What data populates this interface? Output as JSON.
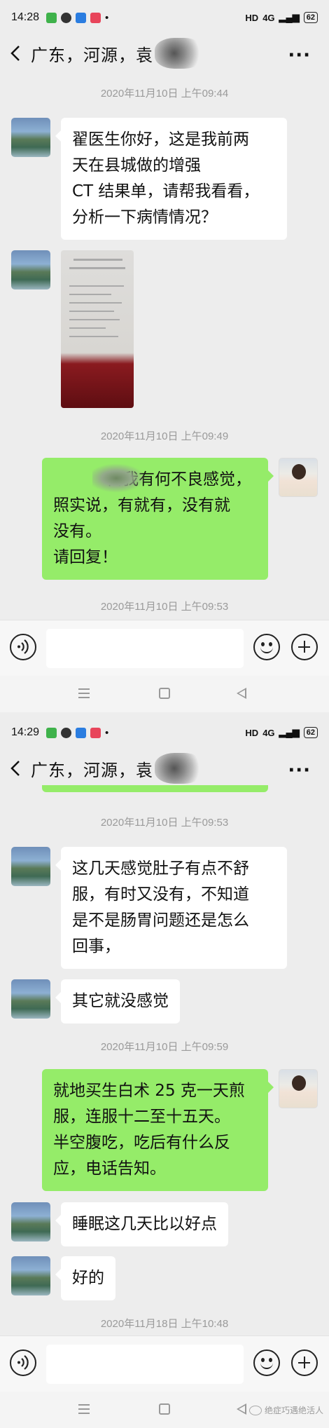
{
  "statusbar": {
    "time_1": "14:28",
    "time_2": "14:29",
    "network": "HD",
    "signal": "4G",
    "battery": "62"
  },
  "chat": {
    "title": "广东，河源，袁"
  },
  "screen1": {
    "ts1": "2020年11月10日 上午09:44",
    "msg1": [
      "翟医生你好，这是我前两",
      "天在县城做的增强",
      "CT 结果单，请帮我看看，",
      "分析一下病情情况？"
    ],
    "ts2": "2020年11月10日 上午09:49",
    "msg2": [
      "自我有何不良感觉，",
      "照实说，有就有，没有就",
      "没有。",
      "请回复！"
    ],
    "ts3": "2020年11月10日 上午09:53"
  },
  "screen2": {
    "ts1": "2020年11月10日 上午09:53",
    "msg1": [
      "这几天感觉肚子有点不舒",
      "服，有时又没有，不知道",
      "是不是肠胃问题还是怎么",
      "回事，"
    ],
    "msg2": "其它就没感觉",
    "ts2": "2020年11月10日 上午09:59",
    "msg3": [
      "就地买生白术 25 克一天煎",
      "服，连服十二至十五天。",
      "半空腹吃，吃后有什么反",
      "应，电话告知。"
    ],
    "msg4": "睡眠这几天比以好点",
    "msg5": "好的",
    "ts3": "2020年11月18日 上午10:48"
  },
  "watermark": "绝症巧遇绝活人",
  "colors": {
    "bg": "#ededed",
    "bubble_self": "#95ec69",
    "bubble_other": "#ffffff"
  }
}
